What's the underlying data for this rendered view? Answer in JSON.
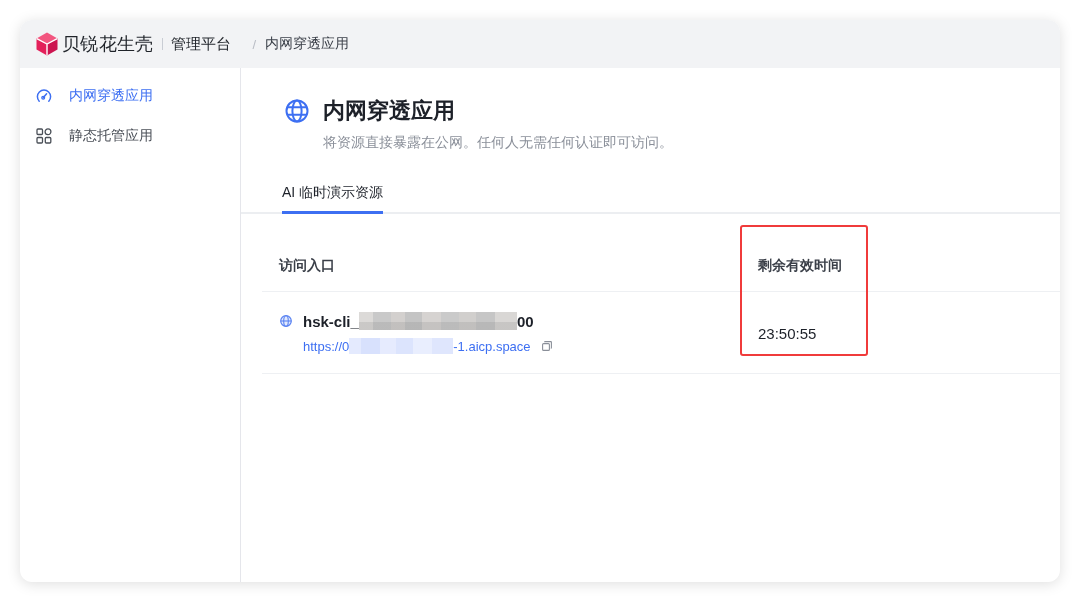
{
  "header": {
    "brand": "贝锐花生壳",
    "product": "管理平台",
    "breadcrumb_separator": "/",
    "breadcrumb": "内网穿透应用"
  },
  "sidebar": {
    "items": [
      {
        "label": "内网穿透应用",
        "selected": true
      },
      {
        "label": "静态托管应用",
        "selected": false
      }
    ]
  },
  "page": {
    "title": "内网穿透应用",
    "description": "将资源直接暴露在公网。任何人无需任何认证即可访问。"
  },
  "tabs": [
    {
      "label": "AI 临时演示资源",
      "selected": true
    }
  ],
  "table": {
    "columns": [
      {
        "label": "访问入口",
        "highlighted": false
      },
      {
        "label": "剩余有效时间",
        "highlighted": true
      }
    ],
    "rows": [
      {
        "name_start": "hsk-cli_",
        "name_end": "00",
        "url_start": "https://0",
        "url_end": "-1.aicp.space",
        "remaining": "23:50:55"
      }
    ]
  }
}
